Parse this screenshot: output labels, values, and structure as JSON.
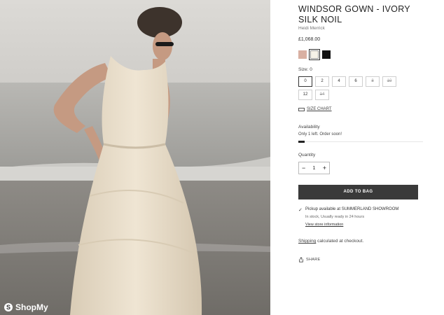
{
  "product": {
    "title": "WINDSOR GOWN - IVORY SILK NOIL",
    "designer": "Heidi Merrick",
    "price": "£1,068.00"
  },
  "colors": [
    {
      "name": "blush-swatch",
      "hex": "#d9b0a2"
    },
    {
      "name": "ivory-swatch",
      "hex": "#f6f2e8"
    },
    {
      "name": "black-swatch",
      "hex": "#111111"
    }
  ],
  "size": {
    "label": "Size: 0",
    "options": [
      {
        "label": "0",
        "state": "selected"
      },
      {
        "label": "2",
        "state": "available"
      },
      {
        "label": "4",
        "state": "available"
      },
      {
        "label": "6",
        "state": "available"
      },
      {
        "label": "8",
        "state": "unavailable"
      },
      {
        "label": "10",
        "state": "unavailable"
      },
      {
        "label": "12",
        "state": "available"
      },
      {
        "label": "14",
        "state": "unavailable"
      }
    ],
    "chart_link": "SIZE CHART"
  },
  "availability": {
    "label": "Availability",
    "text": "Only 1 left. Order soon!",
    "stock_fraction": 0.05
  },
  "quantity": {
    "label": "Quantity",
    "value": "1",
    "minus": "−",
    "plus": "+"
  },
  "add_to_bag": "ADD TO BAG",
  "pickup": {
    "check": "✓",
    "line1": "Pickup available at SUMMERLAND SHOWROOM",
    "line2": "In stock, Usually ready in 24 hours",
    "line3": "View store information"
  },
  "shipping": {
    "link": "Shipping",
    "rest": " calculated at checkout."
  },
  "share": "SHARE",
  "watermark": {
    "icon": "S",
    "text": "ShopMy"
  }
}
